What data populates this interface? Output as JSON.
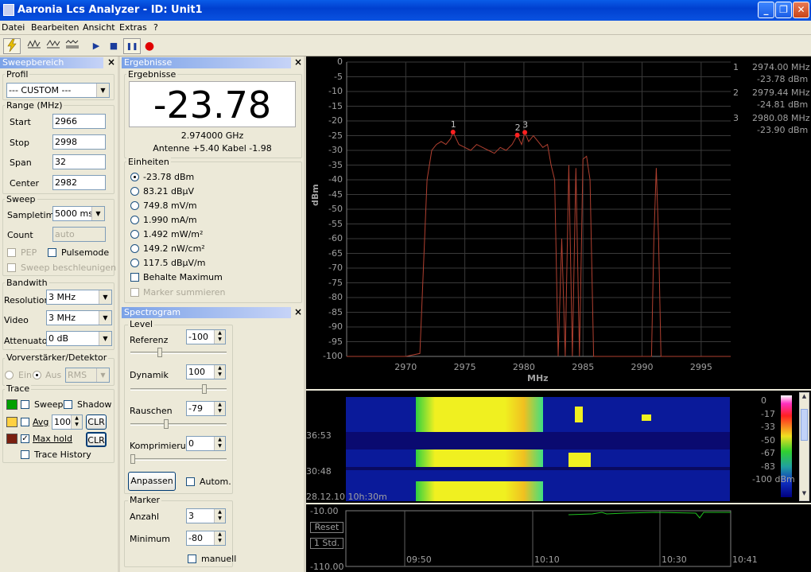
{
  "window": {
    "title": "Aaronia Lcs Analyzer  - ID: Unit1",
    "min": "_",
    "max": "❐",
    "close": "✕"
  },
  "menu": [
    "Datei",
    "Bearbeiten",
    "Ansicht",
    "Extras",
    "?"
  ],
  "toolbar": {
    "play": "▶",
    "stop": "■",
    "pause": "❚❚",
    "record": "●"
  },
  "sweep_panel": {
    "header": "Sweepbereich",
    "profile_label": "Profil",
    "profile_value": "--- CUSTOM ---",
    "range_label": "Range (MHz)",
    "start_label": "Start",
    "start_value": "2966",
    "stop_label": "Stop",
    "stop_value": "2998",
    "span_label": "Span",
    "span_value": "32",
    "center_label": "Center",
    "center_value": "2982",
    "sweep_label": "Sweep",
    "sampletime_label": "Sampletime",
    "sampletime_value": "5000 ms",
    "count_label": "Count",
    "count_value": "auto",
    "pep_label": "PEP",
    "pulsemode_label": "Pulsemode",
    "sweep_accel_label": "Sweep beschleunigen",
    "bandwidth_label": "Bandwith",
    "resolution_label": "Resolution",
    "resolution_value": "3 MHz",
    "video_label": "Video",
    "video_value": "3 MHz",
    "attenuator_label": "Attenuator",
    "attenuator_value": "0 dB",
    "preamp_label": "Vorverstärker/Detektor",
    "ein_label": "Ein",
    "aus_label": "Aus",
    "detector_value": "RMS",
    "trace_label": "Trace",
    "trace_sweep": "Sweep",
    "trace_shadow": "Shadow",
    "trace_avg": "Avg",
    "trace_avg_value": "100",
    "clr": "CLR",
    "trace_maxhold": "Max hold",
    "trace_history": "Trace History",
    "color_sweep": "#00a000",
    "color_avg": "#ffd040",
    "color_maxhold": "#7a2010"
  },
  "results_panel": {
    "header": "Ergebnisse",
    "group_label": "Ergebnisse",
    "big_value": "-23.78",
    "freq": "2.974000 GHz",
    "antenna": "Antenne +5.40 Kabel -1.98",
    "units_label": "Einheiten",
    "units": [
      "-23.78 dBm",
      "83.21 dBµV",
      "749.8 mV/m",
      "1.990 mA/m",
      "1.492 mW/m²",
      "149.2 nW/cm²",
      "117.5 dBµV/m"
    ],
    "keep_max": "Behalte Maximum",
    "marker_sum": "Marker summieren"
  },
  "spectrogram_panel": {
    "header": "Spectrogram",
    "level_label": "Level",
    "referenz_label": "Referenz",
    "referenz_value": "-100",
    "dynamik_label": "Dynamik",
    "dynamik_value": "100",
    "rauschen_label": "Rauschen",
    "rauschen_value": "-79",
    "kompr_label": "Komprimierung",
    "kompr_value": "0",
    "anpassen": "Anpassen",
    "autom": "Autom.",
    "marker_label": "Marker",
    "anzahl_label": "Anzahl",
    "anzahl_value": "3",
    "minimum_label": "Minimum",
    "minimum_value": "-80",
    "manuell": "manuell"
  },
  "plot": {
    "ylabel": "dBm",
    "xlabel": "MHz",
    "yticks": [
      "0",
      "-5",
      "-10",
      "-15",
      "-20",
      "-25",
      "-30",
      "-35",
      "-40",
      "-45",
      "-50",
      "-55",
      "-60",
      "-65",
      "-70",
      "-75",
      "-80",
      "-85",
      "-90",
      "-95",
      "-100"
    ],
    "xticks": [
      "2970",
      "2975",
      "2980",
      "2985",
      "2990",
      "2995"
    ],
    "markers": [
      {
        "n": "1",
        "freq": "2974.00 MHz",
        "level": "-23.78 dBm"
      },
      {
        "n": "2",
        "freq": "2979.44 MHz",
        "level": "-24.81 dBm"
      },
      {
        "n": "3",
        "freq": "2980.08 MHz",
        "level": "-23.90 dBm"
      }
    ]
  },
  "chart_data": {
    "type": "line",
    "xlabel": "MHz",
    "ylabel": "dBm",
    "xlim": [
      2965,
      2997.5
    ],
    "ylim": [
      -100,
      0
    ],
    "series": [
      {
        "x": [
          2965,
          2970,
          2971.2,
          2971.8,
          2972.2,
          2972.6,
          2973,
          2973.4,
          2973.8,
          2974,
          2974.5,
          2975,
          2975.5,
          2976,
          2976.5,
          2977,
          2977.5,
          2978,
          2978.5,
          2979,
          2979.44,
          2979.8,
          2980.08,
          2980.4,
          2980.8,
          2981.2,
          2981.6,
          2982,
          2982.3,
          2982.6,
          2982.9,
          2983.2,
          2983.5,
          2983.8,
          2984.1,
          2984.4,
          2984.7,
          2985,
          2985.3,
          2985.6,
          2985.9,
          2986.2,
          2990.8,
          2991,
          2991.2,
          2991.4,
          2991.6,
          2997.5
        ],
        "y": [
          -100,
          -100,
          -99,
          -40,
          -30,
          -28,
          -27,
          -28,
          -26,
          -23.78,
          -28,
          -29,
          -30,
          -28,
          -29,
          -30,
          -31,
          -29,
          -30,
          -28,
          -24.81,
          -28,
          -23.9,
          -27,
          -25,
          -27,
          -29,
          -28,
          -35,
          -40,
          -100,
          -60,
          -100,
          -35,
          -100,
          -36,
          -100,
          -33,
          -32,
          -40,
          -100,
          -100,
          -100,
          -60,
          -36,
          -60,
          -100,
          -100
        ]
      }
    ]
  },
  "spectrogram": {
    "scale": [
      "0",
      "-17",
      "-33",
      "-50",
      "-67",
      "-83",
      "-100 dBm"
    ],
    "times": [
      "36:53",
      "30:48",
      "28.12.10 10h:30m"
    ]
  },
  "history": {
    "ytop": "-10.00",
    "ybottom": "-110.00",
    "reset": "Reset",
    "std": "1 Std.",
    "times": [
      "09:50",
      "10:10",
      "10:30",
      "10:41"
    ]
  }
}
